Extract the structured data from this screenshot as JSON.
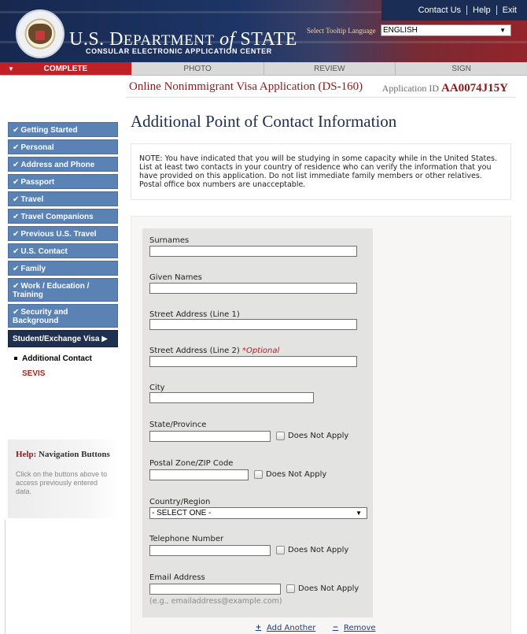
{
  "header": {
    "dept_title_prefix": "U.S. D",
    "dept_title_caps": "EPARTMENT",
    "dept_title_of": "of",
    "dept_title_state": "STATE",
    "subtitle": "CONSULAR ELECTRONIC APPLICATION CENTER",
    "top_links": [
      "Contact Us",
      "Help",
      "Exit"
    ],
    "tooltip_language_label": "Select Tooltip Language",
    "tooltip_language_value": "ENGLISH"
  },
  "progress": {
    "steps": [
      "COMPLETE",
      "PHOTO",
      "REVIEW",
      "SIGN"
    ],
    "active_index": 0
  },
  "application": {
    "title": "Online Nonimmigrant Visa Application (DS-160)",
    "id_label": "Application ID",
    "id_value": "AA0074J15Y"
  },
  "sidebar": {
    "items": [
      {
        "label": "Getting Started"
      },
      {
        "label": "Personal"
      },
      {
        "label": "Address and Phone"
      },
      {
        "label": "Passport"
      },
      {
        "label": "Travel"
      },
      {
        "label": "Travel Companions"
      },
      {
        "label": "Previous U.S. Travel"
      },
      {
        "label": "U.S. Contact"
      },
      {
        "label": "Family"
      },
      {
        "label": "Work / Education / Training"
      },
      {
        "label": "Security and Background"
      }
    ],
    "current": "Student/Exchange Visa",
    "sub_items": [
      "Additional Contact",
      "SEVIS"
    ],
    "help": {
      "title_prefix": "Help:",
      "title": "Navigation Buttons",
      "text": "Click on the buttons above to access previously entered data."
    }
  },
  "main": {
    "heading": "Additional Point of Contact Information",
    "note": "NOTE: You have indicated that you will be studying in some capacity while in the United States. List at least two contacts in your country of residence who can verify the information that you have provided on this application. Do not list immediate family members or other relatives. Postal office box numbers are unacceptable.",
    "fields": {
      "surnames": "Surnames",
      "given_names": "Given Names",
      "street1": "Street Address (Line 1)",
      "street2": "Street Address (Line 2)",
      "street2_optional": "*Optional",
      "city": "City",
      "state": "State/Province",
      "postal": "Postal Zone/ZIP Code",
      "country": "Country/Region",
      "country_value": "- SELECT ONE -",
      "telephone": "Telephone Number",
      "email": "Email Address",
      "email_hint": "(e.g., emailaddress@example.com)"
    },
    "does_not_apply": "Does Not Apply",
    "add_another": "Add Another",
    "remove": "Remove"
  },
  "colors": {
    "nav_blue": "#5a82b4",
    "nav_current": "#1e2f4f",
    "progress_active": "#c02026",
    "accent_red": "#8b1a1a"
  }
}
